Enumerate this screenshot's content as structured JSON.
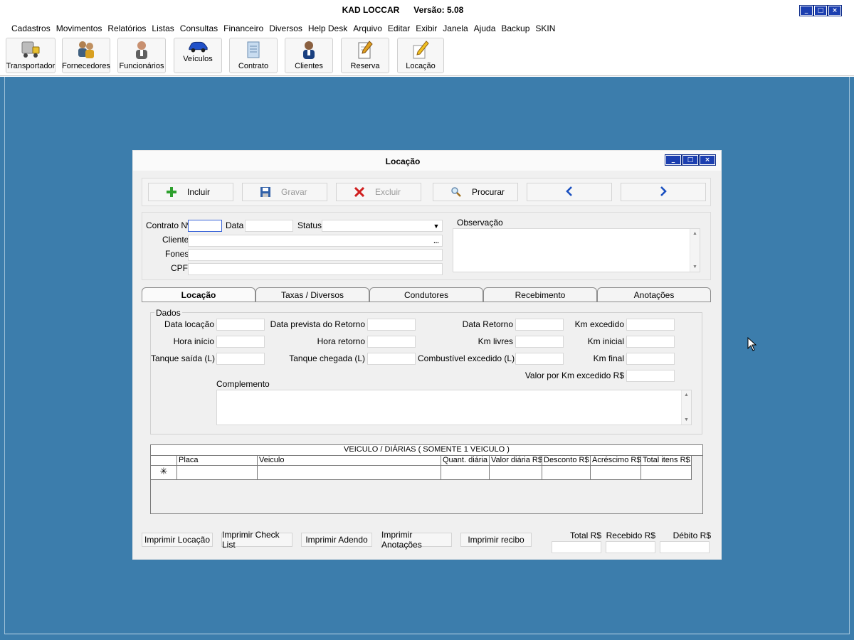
{
  "app": {
    "title": "KAD LOCCAR      Versão: 5.08",
    "window_controls": [
      "_",
      "□",
      "×"
    ]
  },
  "menu": [
    "Cadastros",
    "Movimentos",
    "Relatórios",
    "Listas",
    "Consultas",
    "Financeiro",
    "Diversos",
    "Help Desk",
    "Arquivo",
    "Editar",
    "Exibir",
    "Janela",
    "Ajuda",
    "Backup",
    "SKIN"
  ],
  "toolbar": [
    {
      "label": "Transportador",
      "icon": "truck-icon"
    },
    {
      "label": "Fornecedores",
      "icon": "suppliers-icon"
    },
    {
      "label": "Funcionários",
      "icon": "employee-icon"
    },
    {
      "label": "Veículos",
      "icon": "car-icon"
    },
    {
      "label": "Contrato",
      "icon": "contract-icon"
    },
    {
      "label": "Clientes",
      "icon": "client-icon"
    },
    {
      "label": "Reserva",
      "icon": "reservation-icon"
    },
    {
      "label": "Locação",
      "icon": "rental-icon"
    }
  ],
  "child_window": {
    "title": "Locação",
    "actions": {
      "incluir": "Incluir",
      "gravar": "Gravar",
      "excluir": "Excluir",
      "procurar": "Procurar"
    },
    "header_fields": {
      "contrato_label": "Contrato Nº",
      "contrato_value": "",
      "data_label": "Data",
      "data_value": "",
      "status_label": "Status",
      "status_value": "",
      "cliente_label": "Cliente",
      "cliente_value": "",
      "cliente_lookup": "...",
      "fones_label": "Fones",
      "fones_value": "",
      "cpf_label": "CPF",
      "cpf_value": "",
      "observacao_label": "Observação",
      "observacao_value": ""
    },
    "tabs": [
      "Locação",
      "Taxas / Diversos",
      "Condutores",
      "Recebimento",
      "Anotações"
    ],
    "active_tab": "Locação",
    "dados": {
      "legend": "Dados",
      "data_locacao": "Data locação",
      "hora_inicio": "Hora início",
      "tanque_saida": "Tanque saída (L)",
      "data_prevista": "Data prevista do Retorno",
      "hora_retorno": "Hora retorno",
      "tanque_chegada": "Tanque chegada (L)",
      "data_retorno": "Data Retorno",
      "km_livres": "Km livres",
      "combustivel_excedido": "Combustível excedido (L)",
      "km_excedido": "Km excedido",
      "km_inicial": "Km inicial",
      "km_final": "Km final",
      "valor_km_excedido": "Valor por Km excedido R$",
      "complemento": "Complemento"
    },
    "grid": {
      "caption": "VEICULO / DIÁRIAS ( SOMENTE 1 VEICULO )",
      "columns": [
        "",
        "Placa",
        "Veiculo",
        "Quant. diária",
        "Valor diária R$",
        "Desconto R$",
        "Acréscimo R$",
        "Total itens R$"
      ],
      "new_row_marker": "✳"
    },
    "bottom_buttons": [
      "Imprimir Locação",
      "Imprimir Check List",
      "Imprimir Adendo",
      "Imprimir Anotações",
      "Imprimir recibo"
    ],
    "totals": {
      "total_label": "Total R$",
      "recebido_label": "Recebido R$",
      "debito_label": "Débito R$"
    }
  }
}
